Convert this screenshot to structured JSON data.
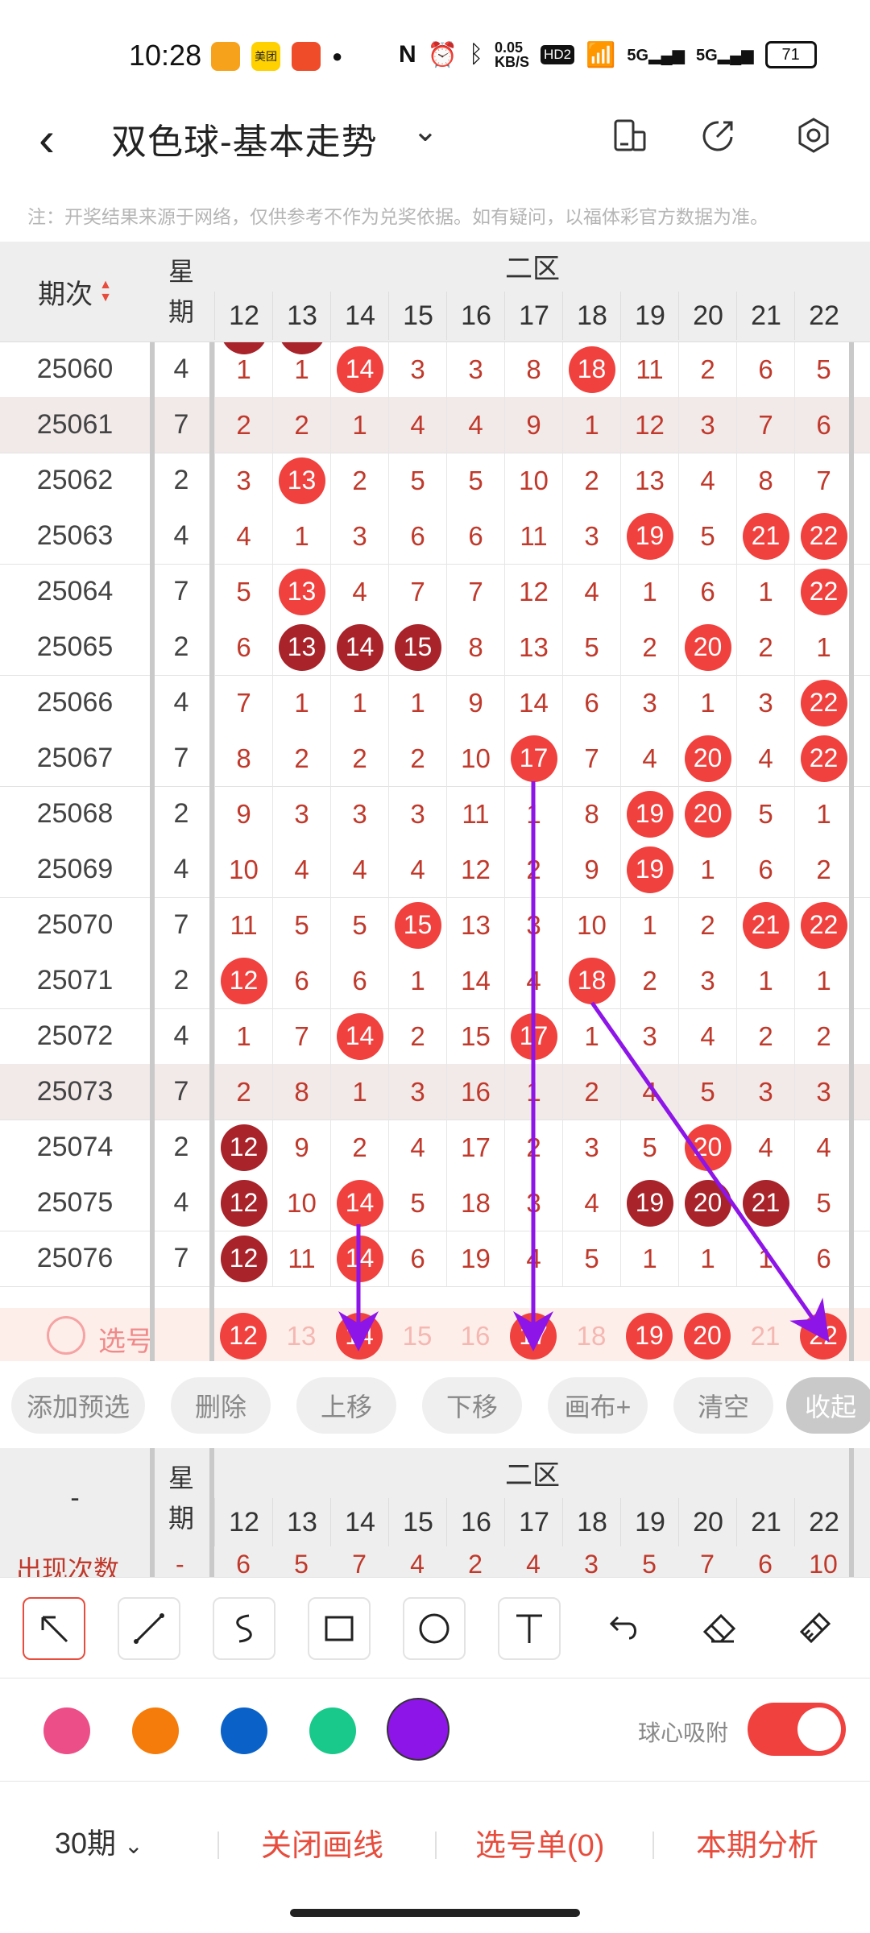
{
  "status": {
    "time": "10:28",
    "net_speed_top": "0.05",
    "net_speed_unit": "KB/S",
    "battery": "71",
    "hd": "HD2",
    "net1": "5G",
    "net2": "5G",
    "meituan": "美团"
  },
  "header": {
    "title": "双色球-基本走势"
  },
  "notice": "注：开奖结果来源于网络，仅供参考不作为兑奖依据。如有疑问，以福体彩官方数据为准。",
  "table": {
    "period_header": "期次",
    "week_header": [
      "星",
      "期"
    ],
    "zone_label": "二区",
    "columns": [
      "12",
      "13",
      "14",
      "15",
      "16",
      "17",
      "18",
      "19",
      "20",
      "21",
      "22"
    ],
    "rows": [
      {
        "period": "25060",
        "week": "4",
        "cells": [
          "1",
          "1",
          "14",
          "3",
          "3",
          "8",
          "18",
          "11",
          "2",
          "6",
          "5"
        ],
        "balls": [
          2,
          6
        ],
        "dark": []
      },
      {
        "period": "25061",
        "week": "7",
        "cells": [
          "2",
          "2",
          "1",
          "4",
          "4",
          "9",
          "1",
          "12",
          "3",
          "7",
          "6"
        ],
        "balls": [],
        "dark": [],
        "shaded": true
      },
      {
        "period": "25062",
        "week": "2",
        "cells": [
          "3",
          "13",
          "2",
          "5",
          "5",
          "10",
          "2",
          "13",
          "4",
          "8",
          "7"
        ],
        "balls": [
          1
        ],
        "dark": []
      },
      {
        "period": "25063",
        "week": "4",
        "cells": [
          "4",
          "1",
          "3",
          "6",
          "6",
          "11",
          "3",
          "19",
          "5",
          "21",
          "22"
        ],
        "balls": [
          7,
          9,
          10
        ],
        "dark": []
      },
      {
        "period": "25064",
        "week": "7",
        "cells": [
          "5",
          "13",
          "4",
          "7",
          "7",
          "12",
          "4",
          "1",
          "6",
          "1",
          "22"
        ],
        "balls": [
          1,
          10
        ],
        "dark": []
      },
      {
        "period": "25065",
        "week": "2",
        "cells": [
          "6",
          "13",
          "14",
          "15",
          "8",
          "13",
          "5",
          "2",
          "20",
          "2",
          "1"
        ],
        "balls": [
          8
        ],
        "dark": [
          1,
          2,
          3
        ]
      },
      {
        "period": "25066",
        "week": "4",
        "cells": [
          "7",
          "1",
          "1",
          "1",
          "9",
          "14",
          "6",
          "3",
          "1",
          "3",
          "22"
        ],
        "balls": [
          10
        ],
        "dark": []
      },
      {
        "period": "25067",
        "week": "7",
        "cells": [
          "8",
          "2",
          "2",
          "2",
          "10",
          "17",
          "7",
          "4",
          "20",
          "4",
          "22"
        ],
        "balls": [
          5,
          8,
          10
        ],
        "dark": []
      },
      {
        "period": "25068",
        "week": "2",
        "cells": [
          "9",
          "3",
          "3",
          "3",
          "11",
          "1",
          "8",
          "19",
          "20",
          "5",
          "1"
        ],
        "balls": [
          7,
          8
        ],
        "dark": []
      },
      {
        "period": "25069",
        "week": "4",
        "cells": [
          "10",
          "4",
          "4",
          "4",
          "12",
          "2",
          "9",
          "19",
          "1",
          "6",
          "2"
        ],
        "balls": [
          7
        ],
        "dark": []
      },
      {
        "period": "25070",
        "week": "7",
        "cells": [
          "11",
          "5",
          "5",
          "15",
          "13",
          "3",
          "10",
          "1",
          "2",
          "21",
          "22"
        ],
        "balls": [
          3,
          9,
          10
        ],
        "dark": []
      },
      {
        "period": "25071",
        "week": "2",
        "cells": [
          "12",
          "6",
          "6",
          "1",
          "14",
          "4",
          "18",
          "2",
          "3",
          "1",
          "1"
        ],
        "balls": [
          0,
          6
        ],
        "dark": []
      },
      {
        "period": "25072",
        "week": "4",
        "cells": [
          "1",
          "7",
          "14",
          "2",
          "15",
          "17",
          "1",
          "3",
          "4",
          "2",
          "2"
        ],
        "balls": [
          2,
          5
        ],
        "dark": []
      },
      {
        "period": "25073",
        "week": "7",
        "cells": [
          "2",
          "8",
          "1",
          "3",
          "16",
          "1",
          "2",
          "4",
          "5",
          "3",
          "3"
        ],
        "balls": [],
        "dark": [],
        "shaded": true
      },
      {
        "period": "25074",
        "week": "2",
        "cells": [
          "12",
          "9",
          "2",
          "4",
          "17",
          "2",
          "3",
          "5",
          "20",
          "4",
          "4"
        ],
        "balls": [
          8
        ],
        "dark": [
          0
        ]
      },
      {
        "period": "25075",
        "week": "4",
        "cells": [
          "12",
          "10",
          "14",
          "5",
          "18",
          "3",
          "4",
          "19",
          "20",
          "21",
          "5"
        ],
        "balls": [
          2
        ],
        "dark": [
          0,
          7,
          8,
          9
        ]
      },
      {
        "period": "25076",
        "week": "7",
        "cells": [
          "12",
          "11",
          "14",
          "6",
          "19",
          "4",
          "5",
          "1",
          "1",
          "1",
          "6"
        ],
        "balls": [
          2
        ],
        "dark": [
          0
        ]
      }
    ],
    "partial_top_row_balls": [
      "12",
      "13"
    ],
    "select_label": "选号",
    "select_cells": [
      "12",
      "13",
      "14",
      "15",
      "16",
      "17",
      "18",
      "19",
      "20",
      "21",
      "22"
    ],
    "select_balls": [
      0,
      2,
      5,
      7,
      8,
      10
    ]
  },
  "buttons": [
    "添加预选",
    "删除",
    "上移",
    "下移",
    "画布+",
    "清空",
    "收起"
  ],
  "stats": {
    "first_col": "-",
    "week_header": [
      "星",
      "期"
    ],
    "zone_label": "二区",
    "columns": [
      "12",
      "13",
      "14",
      "15",
      "16",
      "17",
      "18",
      "19",
      "20",
      "21",
      "22"
    ],
    "row_label": "出现次数",
    "row_week": "-",
    "values": [
      "6",
      "5",
      "7",
      "4",
      "2",
      "4",
      "3",
      "5",
      "7",
      "6",
      "10"
    ]
  },
  "draw_colors": {
    "pink": "#ec4f87",
    "orange": "#f57c0a",
    "blue": "#0a62c8",
    "green": "#19c98b",
    "purple": "#8e15e8"
  },
  "snap_label": "球心吸附",
  "bottom": {
    "periods": "30期",
    "close_lines": "关闭画线",
    "selection": "选号单(0)",
    "analysis": "本期分析"
  },
  "accent": "#f0413e"
}
